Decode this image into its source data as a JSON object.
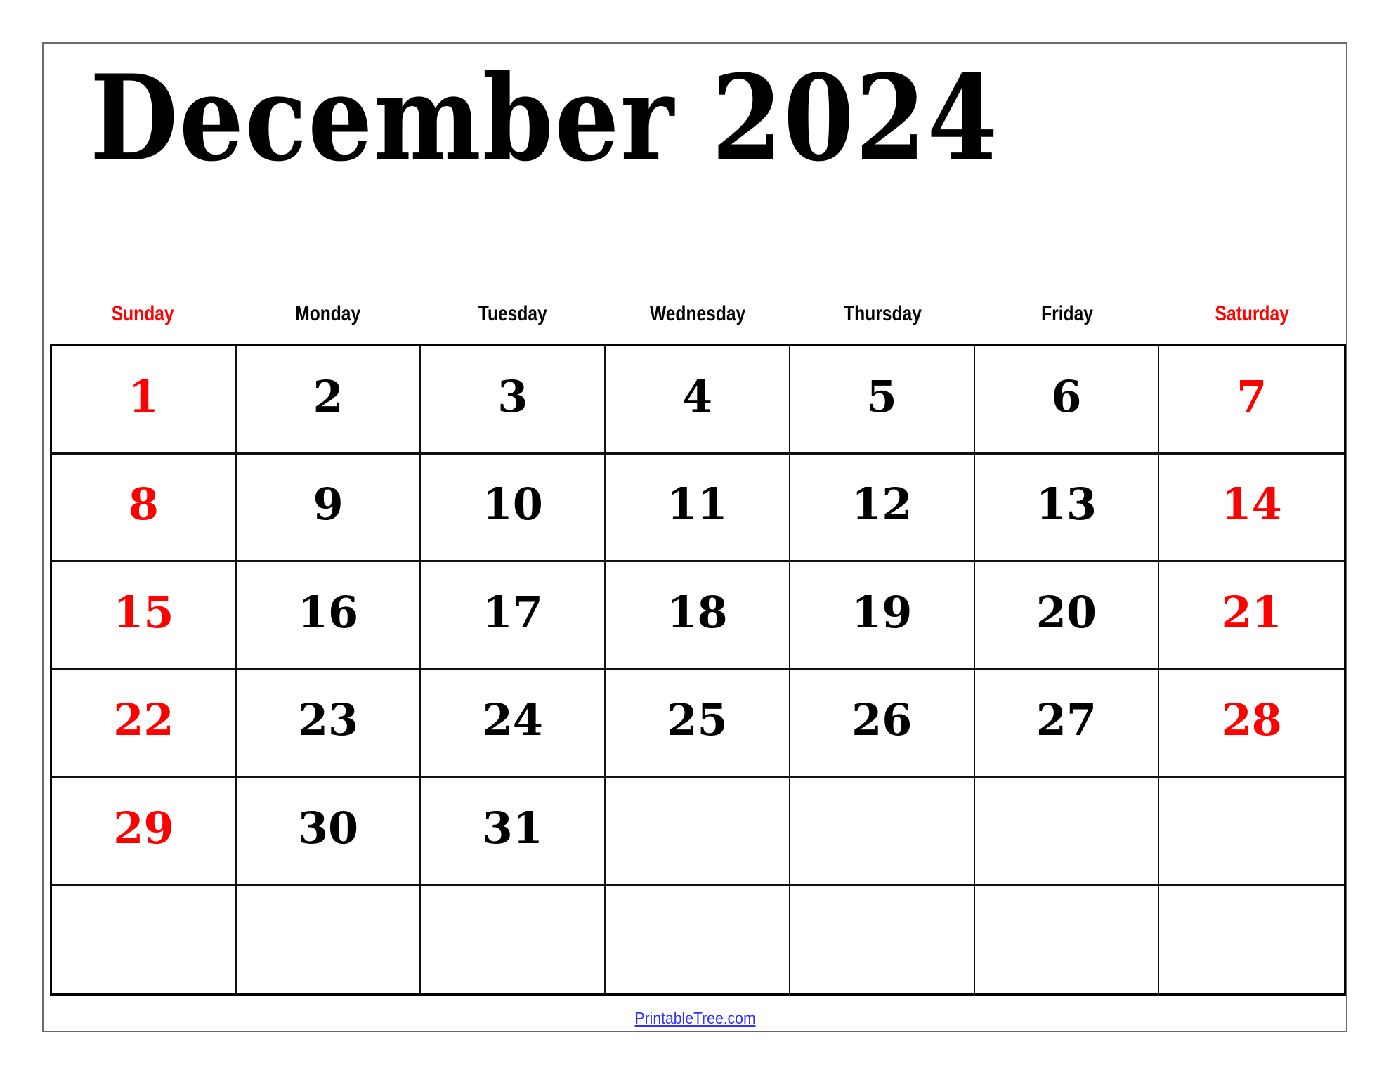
{
  "calendar": {
    "title": "December 2024",
    "month": "December",
    "year": "2024",
    "accent_color": "#ff0000",
    "weekdays": [
      {
        "label": "Sunday",
        "weekend": true
      },
      {
        "label": "Monday",
        "weekend": false
      },
      {
        "label": "Tuesday",
        "weekend": false
      },
      {
        "label": "Wednesday",
        "weekend": false
      },
      {
        "label": "Thursday",
        "weekend": false
      },
      {
        "label": "Friday",
        "weekend": false
      },
      {
        "label": "Saturday",
        "weekend": true
      }
    ],
    "weeks": [
      [
        "1",
        "2",
        "3",
        "4",
        "5",
        "6",
        "7"
      ],
      [
        "8",
        "9",
        "10",
        "11",
        "12",
        "13",
        "14"
      ],
      [
        "15",
        "16",
        "17",
        "18",
        "19",
        "20",
        "21"
      ],
      [
        "22",
        "23",
        "24",
        "25",
        "26",
        "27",
        "28"
      ],
      [
        "29",
        "30",
        "31",
        "",
        "",
        "",
        ""
      ],
      [
        "",
        "",
        "",
        "",
        "",
        "",
        ""
      ]
    ]
  },
  "footer": {
    "link_text": "PrintableTree.com",
    "link_color": "#3030ff"
  }
}
